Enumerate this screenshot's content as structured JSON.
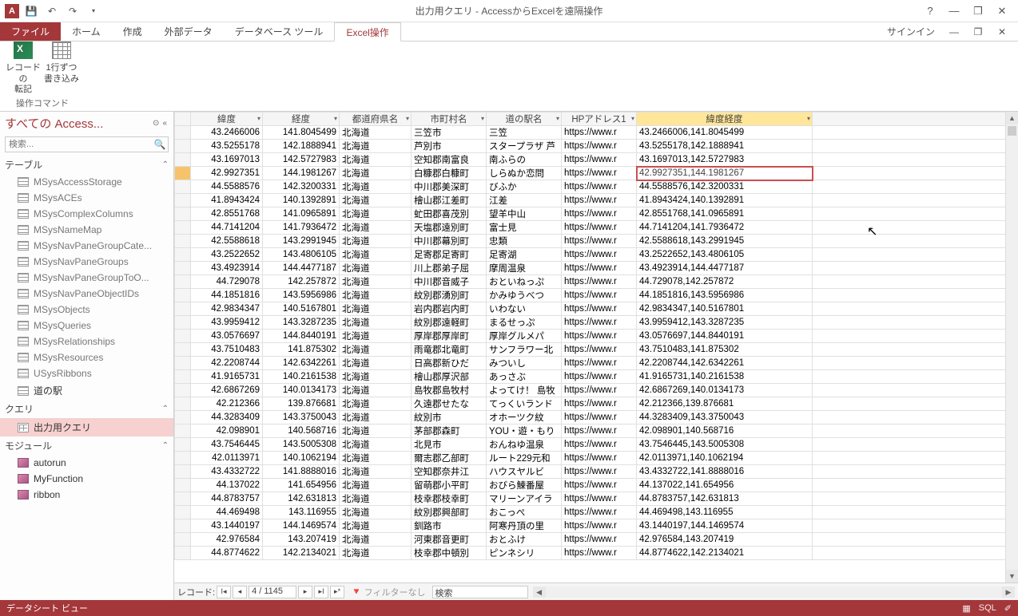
{
  "title": "出力用クエリ - AccessからExcelを遠隔操作",
  "qat": {
    "save": "save-icon",
    "undo": "undo-icon",
    "redo": "redo-icon"
  },
  "signin": "サインイン",
  "tabs": {
    "file": "ファイル",
    "home": "ホーム",
    "create": "作成",
    "external": "外部データ",
    "dbtools": "データベース ツール",
    "excel": "Excel操作"
  },
  "ribbon": {
    "btn1_l1": "レコードの",
    "btn1_l2": "転記",
    "btn2_l1": "1行ずつ",
    "btn2_l2": "書き込み",
    "group": "操作コマンド"
  },
  "nav": {
    "header": "すべての Access...",
    "search_ph": "検索...",
    "sections": {
      "tables": "テーブル",
      "queries": "クエリ",
      "modules": "モジュール"
    },
    "tables": [
      "MSysAccessStorage",
      "MSysACEs",
      "MSysComplexColumns",
      "MSysNameMap",
      "MSysNavPaneGroupCate...",
      "MSysNavPaneGroups",
      "MSysNavPaneGroupToO...",
      "MSysNavPaneObjectIDs",
      "MSysObjects",
      "MSysQueries",
      "MSysRelationships",
      "MSysResources",
      "USysRibbons",
      "道の駅"
    ],
    "queries": [
      "出力用クエリ"
    ],
    "modules": [
      "autorun",
      "MyFunction",
      "ribbon"
    ]
  },
  "columns": [
    "緯度",
    "経度",
    "都道府県名",
    "市町村名",
    "道の駅名",
    "HPアドレス1",
    "緯度経度"
  ],
  "rows": [
    {
      "lat": "43.2466006",
      "lng": "141.8045499",
      "pref": "北海道",
      "city": "三笠市",
      "st": "三笠",
      "url": "https://www.r",
      "ll": "43.2466006,141.8045499"
    },
    {
      "lat": "43.5255178",
      "lng": "142.1888941",
      "pref": "北海道",
      "city": "芦別市",
      "st": "スタープラザ 芦",
      "url": "https://www.r",
      "ll": "43.5255178,142.1888941"
    },
    {
      "lat": "43.1697013",
      "lng": "142.5727983",
      "pref": "北海道",
      "city": "空知郡南富良",
      "st": "南ふらの",
      "url": "https://www.r",
      "ll": "43.1697013,142.5727983"
    },
    {
      "lat": "42.9927351",
      "lng": "144.1981267",
      "pref": "北海道",
      "city": "白糠郡白糠町",
      "st": "しらぬか恋問",
      "url": "https://www.r",
      "ll": "42.9927351,144.1981267",
      "hl": true
    },
    {
      "lat": "44.5588576",
      "lng": "142.3200331",
      "pref": "北海道",
      "city": "中川郡美深町",
      "st": "びふか",
      "url": "https://www.r",
      "ll": "44.5588576,142.3200331"
    },
    {
      "lat": "41.8943424",
      "lng": "140.1392891",
      "pref": "北海道",
      "city": "檜山郡江差町",
      "st": "江差",
      "url": "https://www.r",
      "ll": "41.8943424,140.1392891"
    },
    {
      "lat": "42.8551768",
      "lng": "141.0965891",
      "pref": "北海道",
      "city": "虻田郡喜茂別",
      "st": "望羊中山",
      "url": "https://www.r",
      "ll": "42.8551768,141.0965891"
    },
    {
      "lat": "44.7141204",
      "lng": "141.7936472",
      "pref": "北海道",
      "city": "天塩郡遠別町",
      "st": "富士見",
      "url": "https://www.r",
      "ll": "44.7141204,141.7936472"
    },
    {
      "lat": "42.5588618",
      "lng": "143.2991945",
      "pref": "北海道",
      "city": "中川郡幕別町",
      "st": "忠類",
      "url": "https://www.r",
      "ll": "42.5588618,143.2991945"
    },
    {
      "lat": "43.2522652",
      "lng": "143.4806105",
      "pref": "北海道",
      "city": "足寄郡足寄町",
      "st": "足寄湖",
      "url": "https://www.r",
      "ll": "43.2522652,143.4806105"
    },
    {
      "lat": "43.4923914",
      "lng": "144.4477187",
      "pref": "北海道",
      "city": "川上郡弟子屈",
      "st": "摩周温泉",
      "url": "https://www.r",
      "ll": "43.4923914,144.4477187"
    },
    {
      "lat": "44.729078",
      "lng": "142.257872",
      "pref": "北海道",
      "city": "中川郡音威子",
      "st": "おといねっぷ",
      "url": "https://www.r",
      "ll": "44.729078,142.257872"
    },
    {
      "lat": "44.1851816",
      "lng": "143.5956986",
      "pref": "北海道",
      "city": "紋別郡湧別町",
      "st": "かみゆうべつ",
      "url": "https://www.r",
      "ll": "44.1851816,143.5956986"
    },
    {
      "lat": "42.9834347",
      "lng": "140.5167801",
      "pref": "北海道",
      "city": "岩内郡岩内町",
      "st": "いわない",
      "url": "https://www.r",
      "ll": "42.9834347,140.5167801"
    },
    {
      "lat": "43.9959412",
      "lng": "143.3287235",
      "pref": "北海道",
      "city": "紋別郡遠軽町",
      "st": "まるせっぷ",
      "url": "https://www.r",
      "ll": "43.9959412,143.3287235"
    },
    {
      "lat": "43.0576697",
      "lng": "144.8440191",
      "pref": "北海道",
      "city": "厚岸郡厚岸町",
      "st": "厚岸グルメパ",
      "url": "https://www.r",
      "ll": "43.0576697,144.8440191"
    },
    {
      "lat": "43.7510483",
      "lng": "141.875302",
      "pref": "北海道",
      "city": "雨竜郡北竜町",
      "st": "サンフラワー北",
      "url": "https://www.r",
      "ll": "43.7510483,141.875302"
    },
    {
      "lat": "42.2208744",
      "lng": "142.6342261",
      "pref": "北海道",
      "city": "日高郡新ひだ",
      "st": "みついし",
      "url": "https://www.r",
      "ll": "42.2208744,142.6342261"
    },
    {
      "lat": "41.9165731",
      "lng": "140.2161538",
      "pref": "北海道",
      "city": "檜山郡厚沢部",
      "st": "あっさぶ",
      "url": "https://www.r",
      "ll": "41.9165731,140.2161538"
    },
    {
      "lat": "42.6867269",
      "lng": "140.0134173",
      "pref": "北海道",
      "city": "島牧郡島牧村",
      "st": "よってけ！ 島牧",
      "url": "https://www.r",
      "ll": "42.6867269,140.0134173"
    },
    {
      "lat": "42.212366",
      "lng": "139.876681",
      "pref": "北海道",
      "city": "久遠郡せたな",
      "st": "てっくいランド",
      "url": "https://www.r",
      "ll": "42.212366,139.876681"
    },
    {
      "lat": "44.3283409",
      "lng": "143.3750043",
      "pref": "北海道",
      "city": "紋別市",
      "st": "オホーツク紋",
      "url": "https://www.r",
      "ll": "44.3283409,143.3750043"
    },
    {
      "lat": "42.098901",
      "lng": "140.568716",
      "pref": "北海道",
      "city": "茅部郡森町",
      "st": "YOU・遊・もり",
      "url": "https://www.r",
      "ll": "42.098901,140.568716"
    },
    {
      "lat": "43.7546445",
      "lng": "143.5005308",
      "pref": "北海道",
      "city": "北見市",
      "st": "おんねゆ温泉",
      "url": "https://www.r",
      "ll": "43.7546445,143.5005308"
    },
    {
      "lat": "42.0113971",
      "lng": "140.1062194",
      "pref": "北海道",
      "city": "爾志郡乙部町",
      "st": "ルート229元和",
      "url": "https://www.r",
      "ll": "42.0113971,140.1062194"
    },
    {
      "lat": "43.4332722",
      "lng": "141.8888016",
      "pref": "北海道",
      "city": "空知郡奈井江",
      "st": "ハウスヤルビ",
      "url": "https://www.r",
      "ll": "43.4332722,141.8888016"
    },
    {
      "lat": "44.137022",
      "lng": "141.654956",
      "pref": "北海道",
      "city": "留萌郡小平町",
      "st": "おびら鰊番屋",
      "url": "https://www.r",
      "ll": "44.137022,141.654956"
    },
    {
      "lat": "44.8783757",
      "lng": "142.631813",
      "pref": "北海道",
      "city": "枝幸郡枝幸町",
      "st": "マリーンアイラ",
      "url": "https://www.r",
      "ll": "44.8783757,142.631813"
    },
    {
      "lat": "44.469498",
      "lng": "143.116955",
      "pref": "北海道",
      "city": "紋別郡興部町",
      "st": "おこっぺ",
      "url": "https://www.r",
      "ll": "44.469498,143.116955"
    },
    {
      "lat": "43.1440197",
      "lng": "144.1469574",
      "pref": "北海道",
      "city": "釧路市",
      "st": "阿寒丹頂の里",
      "url": "https://www.r",
      "ll": "43.1440197,144.1469574"
    },
    {
      "lat": "42.976584",
      "lng": "143.207419",
      "pref": "北海道",
      "city": "河東郡音更町",
      "st": "おとふけ",
      "url": "https://www.r",
      "ll": "42.976584,143.207419"
    },
    {
      "lat": "44.8774622",
      "lng": "142.2134021",
      "pref": "北海道",
      "city": "枝幸郡中頓別",
      "st": "ピンネシリ",
      "url": "https://www.r",
      "ll": "44.8774622,142.2134021"
    }
  ],
  "recnav": {
    "label": "レコード:",
    "pos": "4 / 1145",
    "filter": "フィルターなし",
    "search": "検索"
  },
  "status": {
    "view": "データシート ビュー",
    "sql": "SQL"
  }
}
